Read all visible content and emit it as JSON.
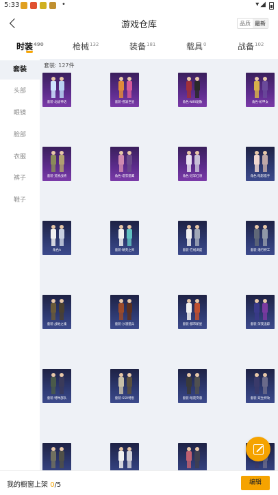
{
  "status": {
    "time": "5:33",
    "extra": "•"
  },
  "header": {
    "title": "游戏仓库",
    "sort": [
      "品质",
      "最新"
    ],
    "sort_active": 1
  },
  "tabs": [
    {
      "label": "时装",
      "count": "490"
    },
    {
      "label": "枪械",
      "count": "132"
    },
    {
      "label": "装备",
      "count": "181"
    },
    {
      "label": "载具",
      "count": "0"
    },
    {
      "label": "战备",
      "count": "102"
    }
  ],
  "sidebar": [
    "套装",
    "头部",
    "眼镜",
    "脸部",
    "衣服",
    "裤子",
    "鞋子"
  ],
  "content": {
    "count_label": "套装: 127件",
    "items": [
      {
        "label": "套装-北极神话",
        "bg": "purple",
        "colors": [
          "#cfe3ff",
          "#b9d2f2"
        ]
      },
      {
        "label": "套装-摇滚巨星",
        "bg": "purple",
        "colors": [
          "#e08a3a",
          "#d45a9a"
        ]
      },
      {
        "label": "角色-NIRI驱散",
        "bg": "purple",
        "colors": [
          "#a0303a",
          "#2a2a2a"
        ]
      },
      {
        "label": "角色-机甲女",
        "bg": "purple",
        "colors": [
          "#d8b04a",
          "#6a4a9a"
        ]
      },
      {
        "label": "套装-荒原战将",
        "bg": "purple",
        "colors": [
          "#8a8a5a",
          "#b0a070"
        ]
      },
      {
        "label": "角色-塔衣猎鹰",
        "bg": "purple",
        "colors": [
          "#d08ab0",
          "#6a4a8a"
        ]
      },
      {
        "label": "角色-冠军红领",
        "bg": "purple",
        "colors": [
          "#e8e0f0",
          "#c8c0d8"
        ]
      },
      {
        "label": "角色-暗影猎手",
        "bg": "blue",
        "colors": [
          "#f0d8d0",
          "#c0a8a8"
        ]
      },
      {
        "label": "角色A",
        "bg": "blue",
        "colors": [
          "#f0f0f0",
          "#c8d0e0"
        ]
      },
      {
        "label": "套装-精英之师",
        "bg": "blue",
        "colors": [
          "#f0f0f0",
          "#60c0c0"
        ]
      },
      {
        "label": "套装-在线调度",
        "bg": "blue",
        "colors": [
          "#f0f0f0",
          "#a0a8b8"
        ]
      },
      {
        "label": "套装-潜行特工",
        "bg": "blue",
        "colors": [
          "#606878",
          "#9098a8"
        ]
      },
      {
        "label": "套装-战地之魂",
        "bg": "blue",
        "colors": [
          "#6a5a3a",
          "#4a4030"
        ]
      },
      {
        "label": "套装-沙漠猎兵",
        "bg": "blue",
        "colors": [
          "#9a4a2a",
          "#5a3020"
        ]
      },
      {
        "label": "套装-都市新星",
        "bg": "blue",
        "colors": [
          "#f0f0f0",
          "#c05030"
        ]
      },
      {
        "label": "套装-深夜追踪",
        "bg": "blue",
        "colors": [
          "#3a3a8a",
          "#7a3aa0"
        ]
      },
      {
        "label": "套装-特种部队",
        "bg": "blue",
        "colors": [
          "#4a5a4a",
          "#3a3a5a"
        ]
      },
      {
        "label": "套装-SSR特别",
        "bg": "blue",
        "colors": [
          "#c8c0a8",
          "#5a5040"
        ]
      },
      {
        "label": "套装-暗夜突袭",
        "bg": "blue",
        "colors": [
          "#3a3a3a",
          "#505050"
        ]
      },
      {
        "label": "套装-双生特攻",
        "bg": "blue",
        "colors": [
          "#3a3a6a",
          "#6a6a8a"
        ]
      },
      {
        "label": "",
        "bg": "blue",
        "colors": [
          "#707060",
          "#505048"
        ]
      },
      {
        "label": "",
        "bg": "blue",
        "colors": [
          "#f0f0f0",
          "#d0d0d8"
        ]
      },
      {
        "label": "",
        "bg": "blue",
        "colors": [
          "#c06070",
          "#404050"
        ]
      },
      {
        "label": "",
        "bg": "blue",
        "colors": [
          "#3a3a6a",
          "#6a6a8a"
        ]
      }
    ]
  },
  "bottom": {
    "label": "我的橱窗上架 ",
    "current": "0",
    "total": "/5",
    "edit": "编辑"
  }
}
